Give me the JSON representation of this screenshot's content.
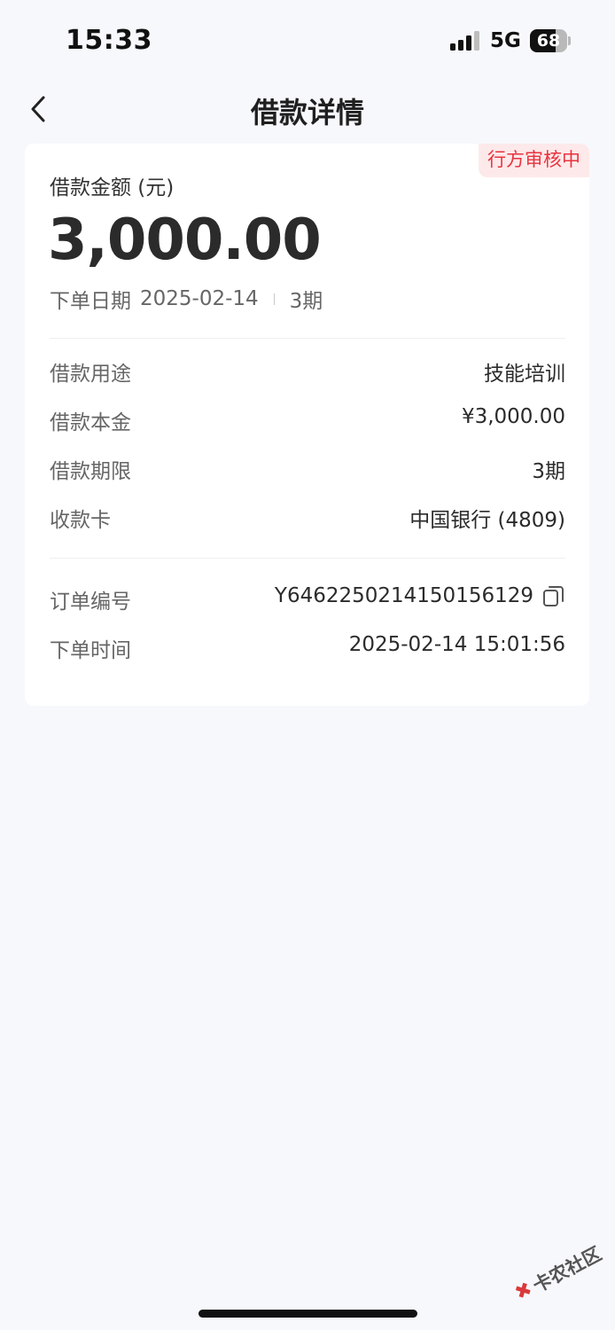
{
  "status_bar": {
    "time": "15:33",
    "network": "5G",
    "battery": "68",
    "battery_level_percent": 68
  },
  "nav": {
    "title": "借款详情",
    "back_icon": "chevron-left-icon"
  },
  "loan": {
    "status_badge": "行方审核中",
    "amount_label": "借款金额 (元)",
    "amount": "3,000.00",
    "order_date_label": "下单日期",
    "order_date": "2025-02-14",
    "term_short": "3期"
  },
  "details": [
    {
      "label": "借款用途",
      "value": "技能培训"
    },
    {
      "label": "借款本金",
      "value": "¥3,000.00"
    },
    {
      "label": "借款期限",
      "value": "3期"
    },
    {
      "label": "收款卡",
      "value": "中国银行 (4809)"
    }
  ],
  "order": {
    "number_label": "订单编号",
    "number": "Y6462250214150156129",
    "time_label": "下单时间",
    "time": "2025-02-14 15:01:56",
    "copy_icon": "copy-icon"
  },
  "watermark": {
    "text": "卡农社区"
  },
  "colors": {
    "page_bg": "#f7f8fc",
    "card_bg": "#ffffff",
    "badge_text": "#e8343f",
    "badge_bg": "#fde9ea"
  }
}
